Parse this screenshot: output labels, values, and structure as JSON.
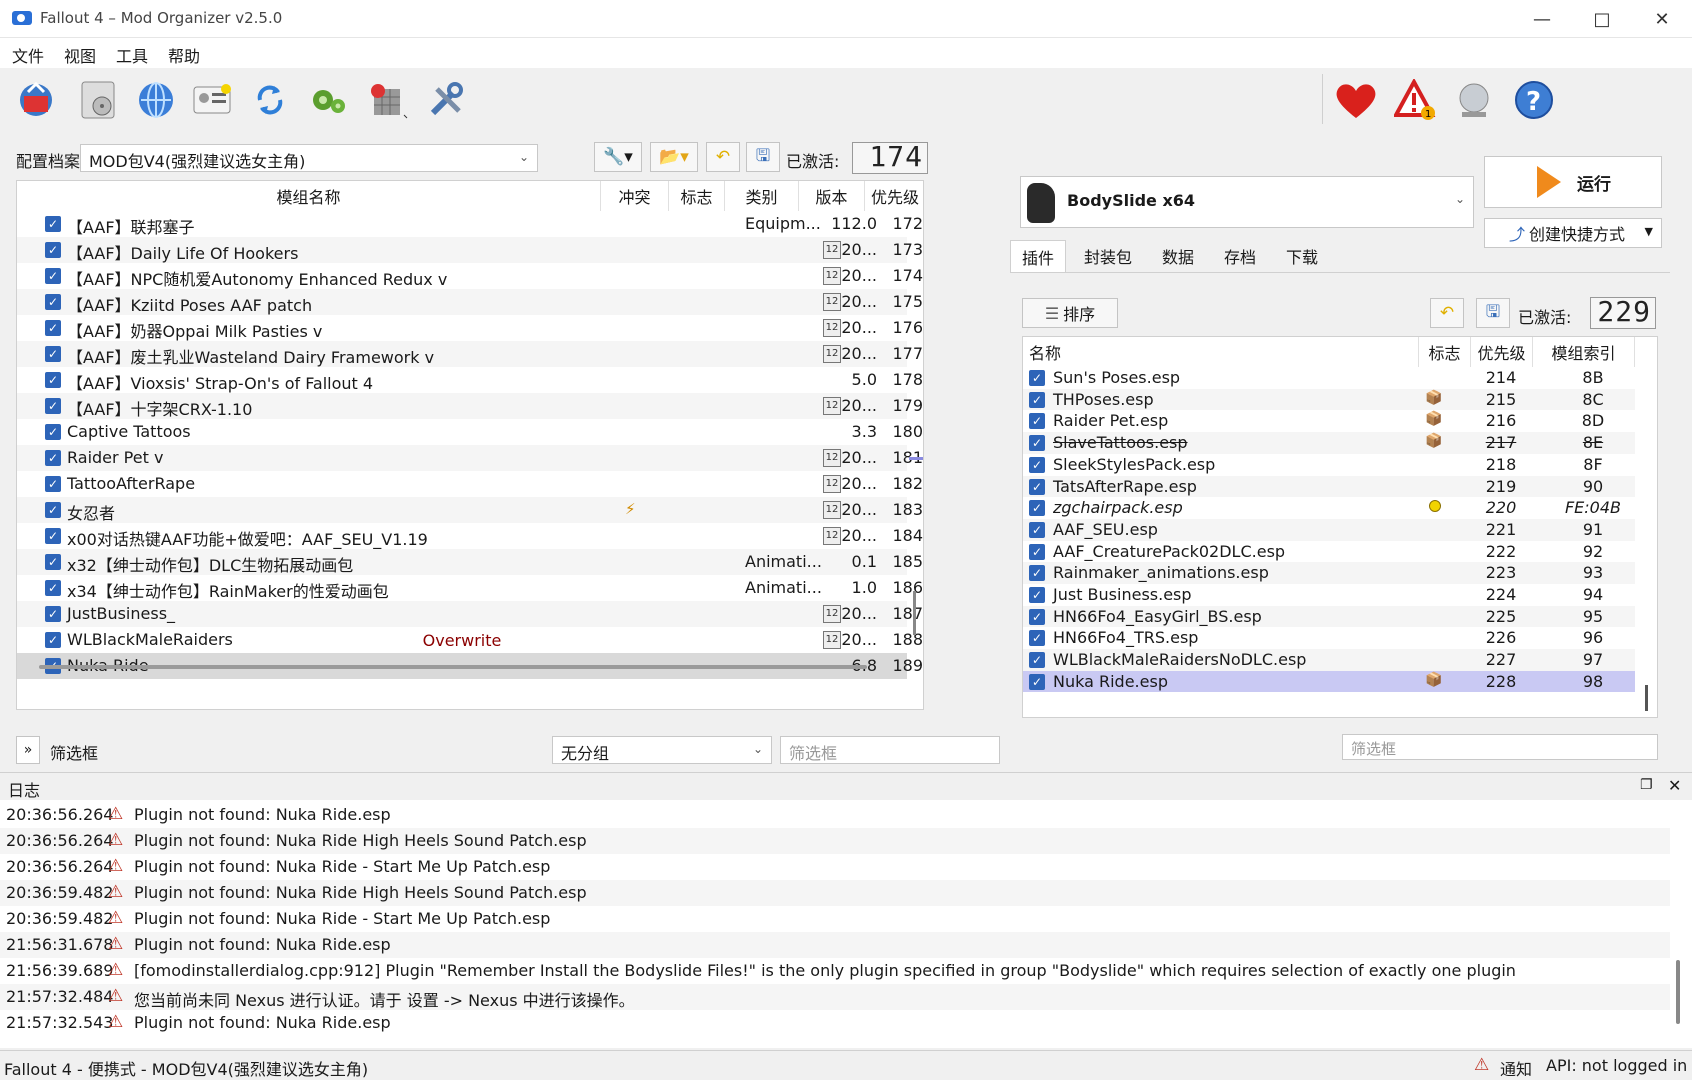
{
  "window": {
    "title": "Fallout 4 – Mod Organizer v2.5.0"
  },
  "menu": [
    "文件",
    "视图",
    "工具",
    "帮助"
  ],
  "profile": {
    "label": "配置档案",
    "value": "MOD包V4(强烈建议选女主角)",
    "active_label": "已激活:",
    "active_count": "174"
  },
  "mod_table": {
    "headers": [
      "模组名称",
      "冲突",
      "标志",
      "类别",
      "版本",
      "优先级"
    ],
    "rows": [
      {
        "name": "【AAF】联邦塞子",
        "category": "Equipm...",
        "version": "112.0",
        "priority": "172",
        "cal": false,
        "flag": ""
      },
      {
        "name": "【AAF】Daily Life Of Hookers",
        "category": "",
        "version": "20...",
        "priority": "173",
        "cal": true,
        "flag": ""
      },
      {
        "name": "【AAF】NPC随机爱Autonomy Enhanced Redux v",
        "category": "",
        "version": "20...",
        "priority": "174",
        "cal": true,
        "flag": ""
      },
      {
        "name": "【AAF】Kziitd Poses AAF patch",
        "category": "",
        "version": "20...",
        "priority": "175",
        "cal": true,
        "flag": ""
      },
      {
        "name": "【AAF】奶器Oppai Milk Pasties v",
        "category": "",
        "version": "20...",
        "priority": "176",
        "cal": true,
        "flag": ""
      },
      {
        "name": "【AAF】废土乳业Wasteland Dairy Framework v",
        "category": "",
        "version": "20...",
        "priority": "177",
        "cal": true,
        "flag": ""
      },
      {
        "name": "【AAF】Vioxsis' Strap-On's of Fallout 4",
        "category": "",
        "version": "5.0",
        "priority": "178",
        "cal": false,
        "flag": ""
      },
      {
        "name": "【AAF】十字架CRX-1.10",
        "category": "",
        "version": "20...",
        "priority": "179",
        "cal": true,
        "flag": ""
      },
      {
        "name": "Captive Tattoos",
        "category": "",
        "version": "3.3",
        "priority": "180",
        "cal": false,
        "flag": ""
      },
      {
        "name": "Raider Pet v",
        "category": "",
        "version": "20...",
        "priority": "181",
        "cal": true,
        "flag": ""
      },
      {
        "name": "TattooAfterRape",
        "category": "",
        "version": "20...",
        "priority": "182",
        "cal": true,
        "flag": ""
      },
      {
        "name": "女忍者",
        "category": "",
        "version": "20...",
        "priority": "183",
        "cal": true,
        "flag": "⚡"
      },
      {
        "name": "x00对话热键AAF功能+做爱吧：AAF_SEU_V1.19",
        "category": "",
        "version": "20...",
        "priority": "184",
        "cal": true,
        "flag": ""
      },
      {
        "name": "x32【绅士动作包】DLC生物拓展动画包",
        "category": "Animati...",
        "version": "0.1",
        "priority": "185",
        "cal": false,
        "flag": ""
      },
      {
        "name": "x34【绅士动作包】RainMaker的性爱动画包",
        "category": "Animati...",
        "version": "1.0",
        "priority": "186",
        "cal": false,
        "flag": ""
      },
      {
        "name": "JustBusiness_",
        "category": "",
        "version": "20...",
        "priority": "187",
        "cal": true,
        "flag": ""
      },
      {
        "name": "WLBlackMaleRaiders",
        "category": "",
        "version": "20...",
        "priority": "188",
        "cal": true,
        "flag": ""
      },
      {
        "name": "Nuka Ride",
        "category": "",
        "version": "6.8",
        "priority": "189",
        "cal": false,
        "flag": ""
      }
    ],
    "overwrite": "Overwrite"
  },
  "filter_bar": {
    "toggle": "»",
    "label": "筛选框",
    "group_value": "无分组",
    "filter_placeholder": "筛选框"
  },
  "executable": {
    "name": "BodySlide x64"
  },
  "run_button": "运行",
  "shortcut_button": "创建快捷方式",
  "tabs": [
    "插件",
    "封装包",
    "数据",
    "存档",
    "下载"
  ],
  "plugins": {
    "sort_button": "排序",
    "active_label": "已激活:",
    "active_count": "229",
    "headers": [
      "名称",
      "标志",
      "优先级",
      "模组索引"
    ],
    "rows": [
      {
        "name": "Sun's Poses.esp",
        "flag": "",
        "priority": "214",
        "index": "8B",
        "style": ""
      },
      {
        "name": "THPoses.esp",
        "flag": "box",
        "priority": "215",
        "index": "8C",
        "style": ""
      },
      {
        "name": "Raider Pet.esp",
        "flag": "box",
        "priority": "216",
        "index": "8D",
        "style": ""
      },
      {
        "name": "SlaveTattoos.esp",
        "flag": "box",
        "priority": "217",
        "index": "8E",
        "style": "strike"
      },
      {
        "name": "SleekStylesPack.esp",
        "flag": "",
        "priority": "218",
        "index": "8F",
        "style": ""
      },
      {
        "name": "TatsAfterRape.esp",
        "flag": "",
        "priority": "219",
        "index": "90",
        "style": ""
      },
      {
        "name": "zgchairpack.esp",
        "flag": "dot",
        "priority": "220",
        "index": "FE:04B",
        "style": "ital"
      },
      {
        "name": "AAF_SEU.esp",
        "flag": "",
        "priority": "221",
        "index": "91",
        "style": ""
      },
      {
        "name": "AAF_CreaturePack02DLC.esp",
        "flag": "",
        "priority": "222",
        "index": "92",
        "style": ""
      },
      {
        "name": "Rainmaker_animations.esp",
        "flag": "",
        "priority": "223",
        "index": "93",
        "style": ""
      },
      {
        "name": "Just Business.esp",
        "flag": "",
        "priority": "224",
        "index": "94",
        "style": ""
      },
      {
        "name": "HN66Fo4_EasyGirl_BS.esp",
        "flag": "",
        "priority": "225",
        "index": "95",
        "style": ""
      },
      {
        "name": "HN66Fo4_TRS.esp",
        "flag": "",
        "priority": "226",
        "index": "96",
        "style": ""
      },
      {
        "name": "WLBlackMaleRaidersNoDLC.esp",
        "flag": "",
        "priority": "227",
        "index": "97",
        "style": ""
      },
      {
        "name": "Nuka Ride.esp",
        "flag": "box",
        "priority": "228",
        "index": "98",
        "style": ""
      }
    ],
    "filter_placeholder": "筛选框"
  },
  "log": {
    "title": "日志",
    "entries": [
      {
        "time": "20:36:56.264",
        "msg": "Plugin not found: Nuka Ride.esp"
      },
      {
        "time": "20:36:56.264",
        "msg": "Plugin not found: Nuka Ride High Heels Sound Patch.esp"
      },
      {
        "time": "20:36:56.264",
        "msg": "Plugin not found: Nuka Ride - Start Me Up Patch.esp"
      },
      {
        "time": "20:36:59.482",
        "msg": "Plugin not found: Nuka Ride High Heels Sound Patch.esp"
      },
      {
        "time": "20:36:59.482",
        "msg": "Plugin not found: Nuka Ride - Start Me Up Patch.esp"
      },
      {
        "time": "21:56:31.678",
        "msg": "Plugin not found: Nuka Ride.esp"
      },
      {
        "time": "21:56:39.689",
        "msg": "[fomodinstallerdialog.cpp:912] Plugin  \"Remember Install the Bodyslide Files!\"  is the only plugin specified in group  \"Bodyslide\"  which requires selection of exactly one plugin"
      },
      {
        "time": "21:57:32.484",
        "msg": "您当前尚未同 Nexus 进行认证。请于 设置 -> Nexus 中进行该操作。"
      },
      {
        "time": "21:57:32.543",
        "msg": "Plugin not found: Nuka Ride.esp"
      }
    ]
  },
  "status": {
    "left": "Fallout 4 - 便携式 - MOD包V4(强烈建议选女主角)",
    "notify": "通知",
    "api": "API: not logged in"
  },
  "colors": {
    "accent": "#2d64b8",
    "overwrite": "#8b0000",
    "selected_plugin": "#c9c9f3",
    "warning": "#c0392b"
  }
}
